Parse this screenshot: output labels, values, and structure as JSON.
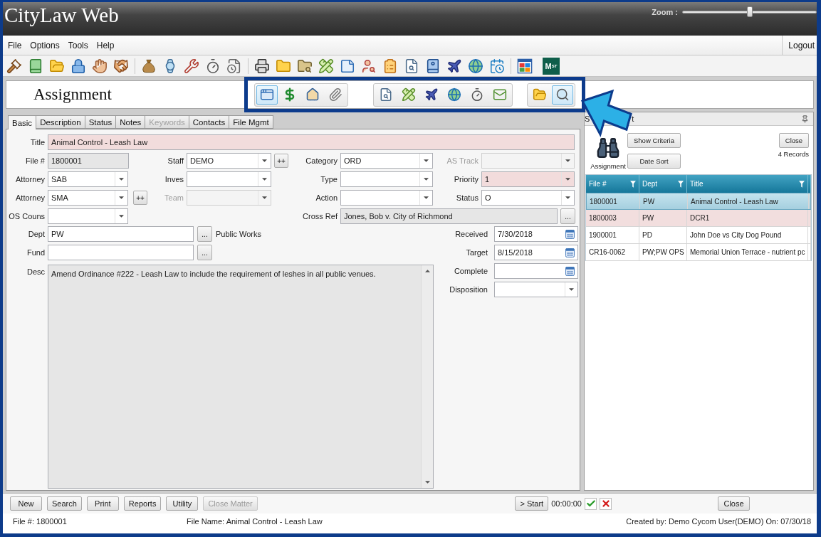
{
  "window": {
    "title": "CityLaw Web",
    "zoom": {
      "label": "Zoom :",
      "level": 0.5
    }
  },
  "menu": {
    "items": [
      "File",
      "Options",
      "Tools",
      "Help"
    ],
    "logout": "Logout"
  },
  "toolbar": {
    "tile_label": "M$^{ST}$"
  },
  "header": {
    "title": "Assignment",
    "tool_groups": [
      [
        {
          "kind": "form",
          "selected": true
        },
        {
          "kind": "money",
          "selected": false
        },
        {
          "kind": "house",
          "selected": false
        },
        {
          "kind": "attachment",
          "selected": false
        }
      ],
      [
        {
          "kind": "preview",
          "selected": false
        },
        {
          "kind": "pencil",
          "selected": false
        },
        {
          "kind": "plane",
          "selected": false
        },
        {
          "kind": "globe",
          "selected": false
        },
        {
          "kind": "timer",
          "selected": false
        },
        {
          "kind": "mail",
          "selected": false
        }
      ],
      [
        {
          "kind": "folder",
          "selected": false
        },
        {
          "kind": "search",
          "selected": true
        }
      ]
    ]
  },
  "tabs": [
    {
      "label": "Basic",
      "selected": true,
      "disabled": false
    },
    {
      "label": "Description",
      "selected": false,
      "disabled": false
    },
    {
      "label": "Status",
      "selected": false,
      "disabled": false
    },
    {
      "label": "Notes",
      "selected": false,
      "disabled": false
    },
    {
      "label": "Keywords",
      "selected": false,
      "disabled": true
    },
    {
      "label": "Contacts",
      "selected": false,
      "disabled": false
    },
    {
      "label": "File Mgmt",
      "selected": false,
      "disabled": false
    }
  ],
  "form": {
    "title": {
      "label": "Title",
      "value": "Animal Control - Leash Law",
      "kind": "text",
      "required": true,
      "read_only": false,
      "disabled": false
    },
    "file_no": {
      "label": "File #",
      "value": "1800001",
      "kind": "text",
      "required": false,
      "read_only": true,
      "disabled": false
    },
    "staff": {
      "label": "Staff",
      "value": "DEMO",
      "kind": "combo",
      "add_button": "++",
      "required": false,
      "read_only": false,
      "disabled": false
    },
    "category": {
      "label": "Category",
      "value": "ORD",
      "kind": "combo",
      "required": false,
      "read_only": false,
      "disabled": false
    },
    "as_track": {
      "label": "AS Track",
      "kind": "combo",
      "required": false,
      "read_only": false,
      "disabled": true
    },
    "attorney": {
      "label": "Attorney",
      "value": "SAB",
      "kind": "combo",
      "required": false,
      "read_only": false,
      "disabled": false
    },
    "inves": {
      "label": "Inves",
      "kind": "combo",
      "required": false,
      "read_only": false,
      "disabled": false
    },
    "type": {
      "label": "Type",
      "kind": "combo",
      "required": false,
      "read_only": false,
      "disabled": false
    },
    "priority": {
      "label": "Priority",
      "value": "1",
      "kind": "combo",
      "required": true,
      "read_only": false,
      "disabled": false
    },
    "attorney_2": {
      "label": "Attorney",
      "value": "SMA",
      "kind": "combo",
      "add_button": "++",
      "required": false,
      "read_only": false,
      "disabled": false
    },
    "team": {
      "label": "Team",
      "kind": "combo",
      "required": false,
      "read_only": false,
      "disabled": true
    },
    "action": {
      "label": "Action",
      "kind": "combo",
      "required": false,
      "read_only": false,
      "disabled": false
    },
    "status": {
      "label": "Status",
      "value": "O",
      "kind": "combo",
      "required": false,
      "read_only": false,
      "disabled": false
    },
    "os_couns": {
      "label": "OS Couns",
      "kind": "combo",
      "required": false,
      "read_only": false,
      "disabled": false
    },
    "cross_ref": {
      "label": "Cross Ref",
      "value": "Jones, Bob v. City of Richmond",
      "kind": "lookup",
      "button": "...",
      "required": false,
      "read_only": true,
      "disabled": false
    },
    "dept": {
      "label": "Dept",
      "value": "PW",
      "kind": "lookup",
      "button": "...",
      "description": "Public Works",
      "required": false,
      "read_only": false,
      "disabled": false
    },
    "fund": {
      "label": "Fund",
      "kind": "lookup",
      "button": "...",
      "required": false,
      "read_only": false,
      "disabled": false
    },
    "desc": {
      "label": "Desc",
      "value": "Amend Ordinance #222 - Leash Law to include the requirement of leshes in all public venues.",
      "kind": "memo",
      "required": false,
      "read_only": true,
      "disabled": false
    },
    "received": {
      "label": "Received",
      "value": "7/30/2018",
      "kind": "date",
      "required": false,
      "read_only": false,
      "disabled": false
    },
    "target": {
      "label": "Target",
      "value": "8/15/2018",
      "kind": "date",
      "required": false,
      "read_only": false,
      "disabled": false
    },
    "complete": {
      "label": "Complete",
      "kind": "date",
      "required": false,
      "read_only": false,
      "disabled": false
    },
    "disposition": {
      "label": "Disposition",
      "kind": "combo",
      "required": false,
      "read_only": false,
      "disabled": false
    }
  },
  "results": {
    "title_fragments": [
      "S",
      "t"
    ],
    "caption": "Assignment",
    "buttons": [
      "Show Criteria",
      "Date Sort"
    ],
    "close": "Close",
    "count": "4 Records",
    "columns": [
      "File #",
      "Dept",
      "Title"
    ],
    "rows": [
      {
        "cells": [
          "1800001",
          "PW",
          "Animal Control - Leash Law"
        ],
        "selected": true,
        "flagged": false
      },
      {
        "cells": [
          "1800003",
          "PW",
          "DCR1"
        ],
        "selected": false,
        "flagged": true
      },
      {
        "cells": [
          "1900001",
          "PD",
          "John Doe vs City Dog Pound"
        ],
        "selected": false,
        "flagged": false
      },
      {
        "cells": [
          "CR16-0062",
          "PW;PW OPS",
          "Memorial Union Terrace - nutrient pc"
        ],
        "selected": false,
        "flagged": false
      }
    ]
  },
  "actions": {
    "buttons": [
      {
        "label": "New",
        "disabled": false
      },
      {
        "label": "Search",
        "disabled": false
      },
      {
        "label": "Print",
        "disabled": false
      },
      {
        "label": "Reports",
        "disabled": false
      },
      {
        "label": "Utility",
        "disabled": false
      },
      {
        "label": "Close Matter",
        "disabled": true
      }
    ],
    "timer": {
      "start": "> Start",
      "time": "00:00:00"
    },
    "close": "Close"
  },
  "status_bar": {
    "file_no": "File #: 1800001",
    "file_name": "File Name: Animal Control - Leash Law",
    "created": "Created by: Demo Cycom User(DEMO) On: 07/30/18"
  }
}
